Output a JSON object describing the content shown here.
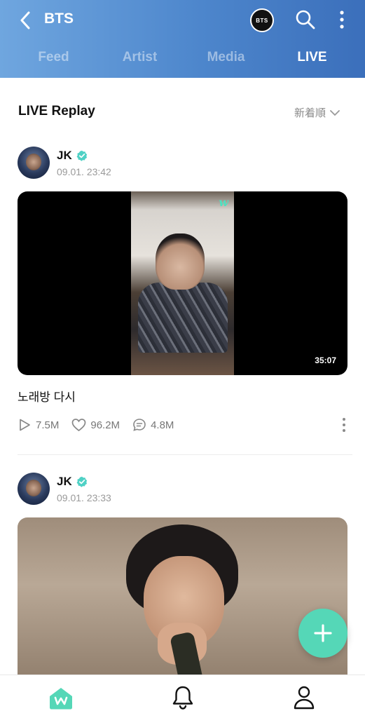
{
  "header": {
    "title": "BTS",
    "badge_label": "BTS",
    "tabs": [
      {
        "label": "Feed"
      },
      {
        "label": "Artist"
      },
      {
        "label": "Media"
      },
      {
        "label": "LIVE"
      }
    ],
    "active_tab": "LIVE"
  },
  "section": {
    "title": "LIVE Replay",
    "sort_label": "新着順"
  },
  "posts": [
    {
      "author": "JK",
      "date": "09.01. 23:42",
      "duration": "35:07",
      "title": "노래방 다시",
      "plays": "7.5M",
      "likes": "96.2M",
      "comments": "4.8M",
      "watermark": "w"
    },
    {
      "author": "JK",
      "date": "09.01. 23:33"
    }
  ],
  "colors": {
    "header_start": "#6fa6df",
    "header_end": "#3b6fbb",
    "accent": "#55d7b7",
    "verified": "#4fd1c5"
  },
  "icons": [
    "back-icon",
    "search-icon",
    "more-vert-icon",
    "verified-icon",
    "play-icon",
    "heart-icon",
    "comment-icon",
    "plus-icon",
    "home-icon",
    "bell-icon",
    "user-icon"
  ]
}
